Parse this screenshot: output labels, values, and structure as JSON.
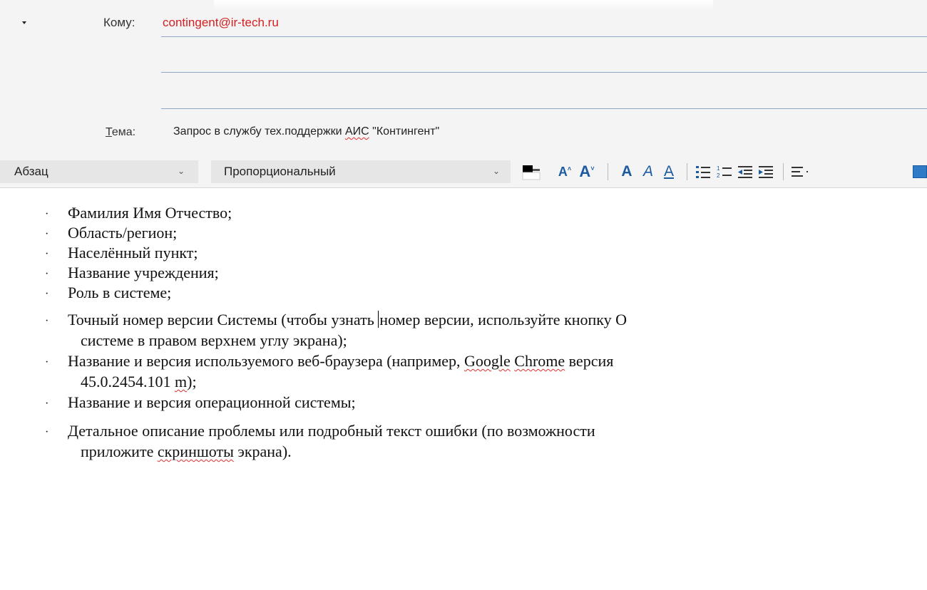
{
  "header": {
    "to_label": "Кому:",
    "to_value": "contingent@ir-tech.ru",
    "subject_label_first": "Т",
    "subject_label_rest": "ема:",
    "subject_value_a": "Запрос в службу тех.поддержки ",
    "subject_value_b": "АИС",
    "subject_value_c": " \"Контингент\""
  },
  "toolbar": {
    "paragraph_style": "Абзац",
    "font_name": "Пропорциональный"
  },
  "body": {
    "bullet": "·",
    "items": [
      "Фамилия Имя Отчество;",
      "Область/регион;",
      "Населённый пункт;",
      "Название учреждения;",
      "Роль в системе;"
    ],
    "item6_line1_a": "Точный номер версии Системы (чтобы узнать ",
    "item6_line1_b": "номер версии, используйте кнопку О",
    "item6_line2": "системе в правом верхнем углу экрана);",
    "item7_line1_a": "Название и версия используемого веб-браузера (например, ",
    "item7_line1_b": "Google",
    "item7_line1_c": " ",
    "item7_line1_d": "Chrome",
    "item7_line1_e": " версия",
    "item7_line2_a": "45.0.2454.101 ",
    "item7_line2_b": "m",
    "item7_line2_c": ");",
    "item8": "Название и версия операционной системы;",
    "item9_line1": "Детальное описание проблемы или подробный текст ошибки (по возможности",
    "item9_line2_a": "приложите ",
    "item9_line2_b": "скриншоты",
    "item9_line2_c": " экрана)."
  },
  "icons": {
    "recipients_dropdown": "chevron-down-icon",
    "font_color": "font-color-icon",
    "grow_font": "grow-font-icon",
    "shrink_font": "shrink-font-icon",
    "bold": "bold-icon",
    "italic": "italic-icon",
    "underline": "underline-icon",
    "bullets": "bulleted-list-icon",
    "numbering": "numbered-list-icon",
    "outdent": "decrease-indent-icon",
    "indent": "increase-indent-icon",
    "align": "align-left-icon"
  },
  "colors": {
    "recipient": "#d42020",
    "accent": "#1c5aa0",
    "spellcheck": "#e03030"
  }
}
